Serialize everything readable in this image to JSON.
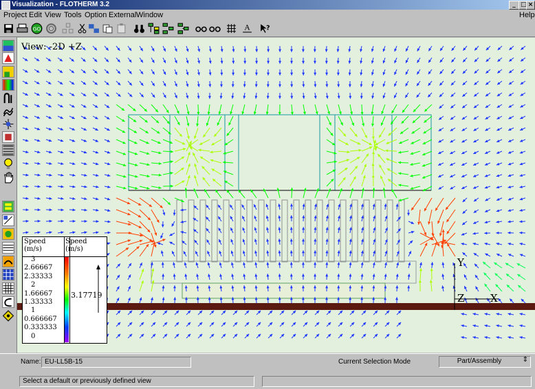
{
  "window": {
    "title": "Visualization - FLOTHERM 3.2"
  },
  "menu": [
    "Project",
    "Edit",
    "View",
    "Tools",
    "Option",
    "External",
    "Window",
    "Help"
  ],
  "toolbar_icons": [
    "save-icon",
    "print-icon",
    "go-icon",
    "spiral-icon",
    "assembly-icon",
    "cut-icon",
    "copy-icon",
    "paste-icon",
    "clipboard-icon",
    "binoculars-icon",
    "tree-icon",
    "tree-alt-icon",
    "tree-link-icon",
    "glasses-icon",
    "glasses-alt-icon",
    "grid-icon",
    "text-tool-icon",
    "help-pointer-icon"
  ],
  "left_tools": [
    "surface-plot-icon",
    "profile-icon",
    "isosurface-icon",
    "colormap-icon",
    "streamline-icon",
    "particle-icon",
    "vector-icon",
    "dashboard-icon",
    "grid-view-icon",
    "lightbulb-icon",
    "hand-icon",
    "layers-icon",
    "probe-icon",
    "contour-icon",
    "graph-icon",
    "flow-icon",
    "mesh-icon",
    "curl-icon",
    "arrow-diamond-icon"
  ],
  "view": {
    "label": "View:  -2D +Z"
  },
  "legend": {
    "header_left": "Speed\n(m/s)",
    "header_right": "Speed\n(m/s)",
    "values": [
      "3",
      "2.66667",
      "2.33333",
      "2",
      "1.66667",
      "1.33333",
      "1",
      "0.666667",
      "0.333333",
      "0"
    ],
    "current_value": "3.17719"
  },
  "axes": {
    "y": "Y",
    "z": "Z",
    "x": "X"
  },
  "status": {
    "name_label": "Name:",
    "name_value": "EU-LL5B-15",
    "mode_label": "Current Selection Mode",
    "mode_value": "Part/Assembly",
    "message": "Select a default or previously defined view"
  },
  "colors": {
    "titlebar": "#0a246a",
    "view_bg": "#e4f0de",
    "ground": "#5a1a10"
  }
}
